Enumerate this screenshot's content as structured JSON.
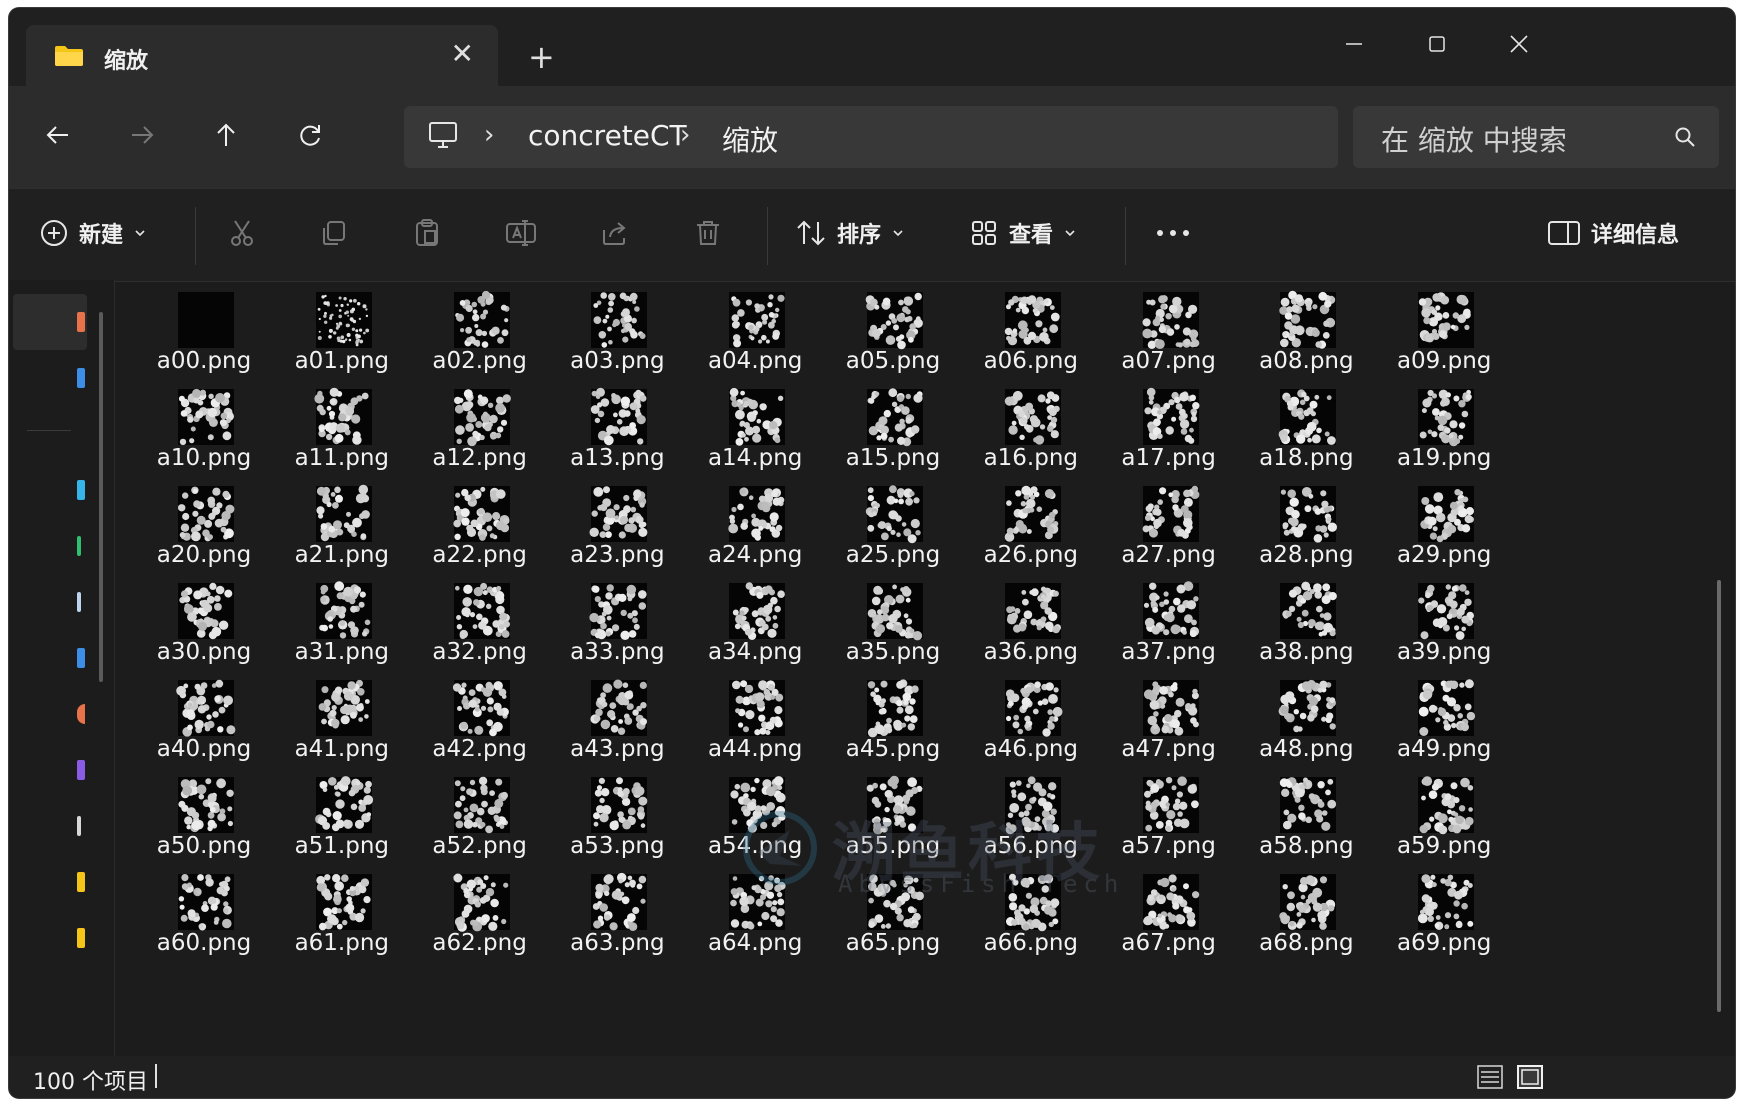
{
  "tab": {
    "title": "缩放"
  },
  "address": {
    "crumbs": [
      "concreteCT",
      "缩放"
    ]
  },
  "search": {
    "placeholder": "在 缩放 中搜索"
  },
  "toolbar": {
    "new_label": "新建",
    "sort_label": "排序",
    "view_label": "查看",
    "details_label": "详细信息"
  },
  "files": [
    "a00.png",
    "a01.png",
    "a02.png",
    "a03.png",
    "a04.png",
    "a05.png",
    "a06.png",
    "a07.png",
    "a08.png",
    "a09.png",
    "a10.png",
    "a11.png",
    "a12.png",
    "a13.png",
    "a14.png",
    "a15.png",
    "a16.png",
    "a17.png",
    "a18.png",
    "a19.png",
    "a20.png",
    "a21.png",
    "a22.png",
    "a23.png",
    "a24.png",
    "a25.png",
    "a26.png",
    "a27.png",
    "a28.png",
    "a29.png",
    "a30.png",
    "a31.png",
    "a32.png",
    "a33.png",
    "a34.png",
    "a35.png",
    "a36.png",
    "a37.png",
    "a38.png",
    "a39.png",
    "a40.png",
    "a41.png",
    "a42.png",
    "a43.png",
    "a44.png",
    "a45.png",
    "a46.png",
    "a47.png",
    "a48.png",
    "a49.png",
    "a50.png",
    "a51.png",
    "a52.png",
    "a53.png",
    "a54.png",
    "a55.png",
    "a56.png",
    "a57.png",
    "a58.png",
    "a59.png",
    "a60.png",
    "a61.png",
    "a62.png",
    "a63.png",
    "a64.png",
    "a65.png",
    "a66.png",
    "a67.png",
    "a68.png",
    "a69.png"
  ],
  "watermark": {
    "title": "溯鱼科技",
    "subtitle": "AbyssFish Tech"
  },
  "status": {
    "item_count": "100 个项目"
  },
  "colors": {
    "window_bg": "#1c1c1c",
    "accent_folder": "#f5c518"
  }
}
